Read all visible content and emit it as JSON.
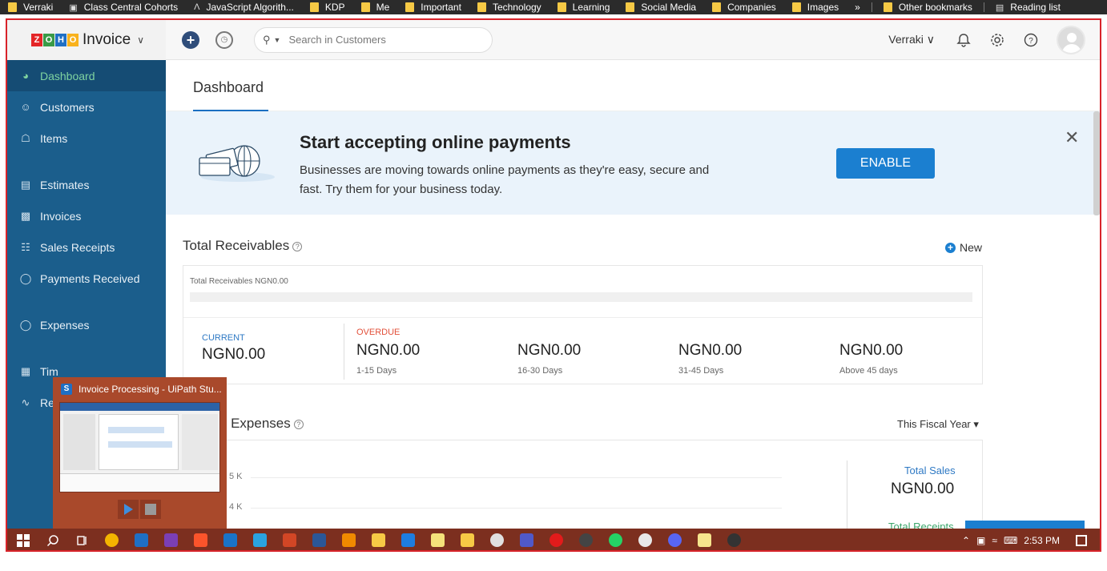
{
  "bookmarks": {
    "items": [
      {
        "label": "Verraki",
        "icon": "folder-icon"
      },
      {
        "label": "Class Central Cohorts",
        "icon": "page-icon"
      },
      {
        "label": "JavaScript Algorith...",
        "icon": "lambda-icon"
      },
      {
        "label": "KDP",
        "icon": "folder-icon"
      },
      {
        "label": "Me",
        "icon": "folder-icon"
      },
      {
        "label": "Important",
        "icon": "folder-icon"
      },
      {
        "label": "Technology",
        "icon": "folder-icon"
      },
      {
        "label": "Learning",
        "icon": "folder-icon"
      },
      {
        "label": "Social Media",
        "icon": "folder-icon"
      },
      {
        "label": "Companies",
        "icon": "folder-icon"
      },
      {
        "label": "Images",
        "icon": "folder-icon"
      }
    ],
    "overflow": "»",
    "other": "Other bookmarks",
    "reading": "Reading list"
  },
  "header": {
    "brand_letters": [
      "Z",
      "O",
      "H",
      "O"
    ],
    "brand_name": "Invoice",
    "search_placeholder": "Search in Customers",
    "org_name": "Verraki",
    "colors": {
      "accent": "#1b7fd0",
      "sidebar": "#1b5e8c",
      "active_text": "#7fd3a0"
    }
  },
  "sidebar": {
    "items": [
      {
        "label": "Dashboard",
        "icon": "gauge-icon"
      },
      {
        "label": "Customers",
        "icon": "user-icon"
      },
      {
        "label": "Items",
        "icon": "basket-icon"
      },
      {
        "label": "Estimates",
        "icon": "estimate-icon"
      },
      {
        "label": "Invoices",
        "icon": "invoice-icon"
      },
      {
        "label": "Sales Receipts",
        "icon": "receipt-icon"
      },
      {
        "label": "Payments Received",
        "icon": "payment-icon"
      },
      {
        "label": "Expenses",
        "icon": "expense-icon"
      },
      {
        "label": "Tim",
        "icon": "timesheet-icon"
      },
      {
        "label": "Rep",
        "icon": "reports-icon"
      }
    ]
  },
  "main": {
    "tab": "Dashboard",
    "banner": {
      "title": "Start accepting online payments",
      "description": "Businesses are moving towards online payments as they're easy, secure and fast. Try them for your business today.",
      "button": "ENABLE"
    },
    "receivables": {
      "title": "Total Receivables",
      "new_label": "New",
      "subtitle": "Total Receivables NGN0.00",
      "current_label": "CURRENT",
      "current_amount": "NGN0.00",
      "overdue_label": "OVERDUE",
      "buckets": [
        {
          "amount": "NGN0.00",
          "range": "1-15 Days"
        },
        {
          "amount": "NGN0.00",
          "range": "16-30 Days"
        },
        {
          "amount": "NGN0.00",
          "range": "31-45 Days"
        },
        {
          "amount": "NGN0.00",
          "range": "Above 45 days"
        }
      ]
    },
    "sales_expenses": {
      "title_partial": "and Expenses",
      "period": "This Fiscal Year",
      "y_ticks": [
        "5 K",
        "4 K"
      ],
      "total_sales_label": "Total Sales",
      "total_sales_amount": "NGN0.00",
      "total_receipts_label": "Total Receipts"
    }
  },
  "preview": {
    "title": "Invoice Processing - UiPath Stu...",
    "logo": "S"
  },
  "taskbar": {
    "apps": [
      "windows-icon",
      "search-icon",
      "task-view-icon",
      "chrome-icon",
      "uipath-icon",
      "onenote-icon",
      "brave-icon",
      "outlook-icon",
      "telegram-icon",
      "powerpoint-icon",
      "word-icon",
      "vlc-icon",
      "files-icon",
      "trello-icon",
      "notepad-icon",
      "explorer-icon",
      "slack-app-icon",
      "teams-icon",
      "youtube-icon",
      "github-icon",
      "whatsapp-icon",
      "slack-icon",
      "discord-icon",
      "notes-icon",
      "obs-icon"
    ],
    "time": "2:53 PM"
  }
}
